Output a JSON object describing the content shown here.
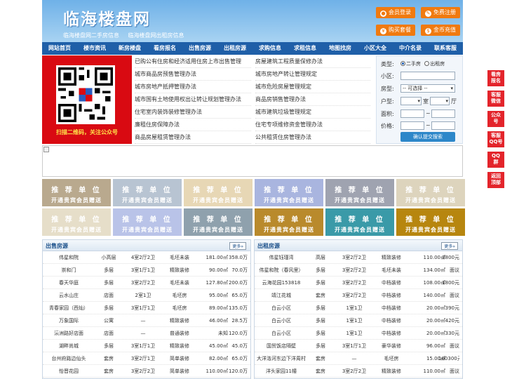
{
  "header": {
    "title": "临海楼盘网",
    "subtitle_links": [
      "临海楼盘网二手房信息",
      "临海楼盘网出租房信息"
    ],
    "buttons": [
      {
        "label": "会员登录",
        "icon": "user-icon"
      },
      {
        "label": "免费注册",
        "icon": "pen-icon"
      },
      {
        "label": "购买套餐",
        "icon": "cart-icon"
      },
      {
        "label": "金币充值",
        "icon": "coin-icon"
      }
    ]
  },
  "nav": [
    "网站首页",
    "楼市资讯",
    "新房楼盘",
    "看房报名",
    "出售房源",
    "出租房源",
    "求购信息",
    "求租信息",
    "地图找房",
    "小区大全",
    "中介名录",
    "联系客服"
  ],
  "qr": {
    "caption": "扫描二维码，关注公众号",
    "accent": "#d90a12"
  },
  "links": {
    "left": [
      "已购公有住房和经济适用住房上市出售管理",
      "城市商品房预售管理办法",
      "城市房地产抵押管理办法",
      "城市国有土地使用权出让转让规划管理办法",
      "住宅室内装饰装修管理办法",
      "廉租住房保障办法",
      "商品房屋租赁管理办法"
    ],
    "right": [
      "房屋建筑工程质量保修办法",
      "城市房地产转让管理规定",
      "城市危险房屋管理规定",
      "商品房销售管理办法",
      "城市建筑垃圾管理规定",
      "住宅专项维修资金管理办法",
      "公共租赁住房管理办法"
    ]
  },
  "search": {
    "type_label": "类型:",
    "type_options": [
      "二手房",
      "出租房"
    ],
    "community_label": "小区:",
    "house_type_label": "房型:",
    "house_type_value": "-- 可选择 --",
    "layout_label": "户型:",
    "room_unit": "室",
    "hall_unit": "厅",
    "area_label": "面积:",
    "price_label": "价格:",
    "range_sep": "~",
    "submit_label": "确认提交搜索"
  },
  "ads": {
    "line1": "推 荐 单 位",
    "line2": "开通贵宾会员赠送"
  },
  "sale": {
    "title": "出售房源",
    "more": "更多»",
    "rows": [
      [
        "伟星和院",
        "小高层",
        "4室2厅2卫",
        "毛坯未装",
        "181.00㎡",
        "358.0万"
      ],
      [
        "崇和门",
        "多层",
        "3室1厅1卫",
        "精致装修",
        "90.00㎡",
        "70.0万"
      ],
      [
        "春天华庭",
        "多层",
        "3室2厅2卫",
        "毛坯未装",
        "127.80㎡",
        "200.0万"
      ],
      [
        "云水山庄",
        "店面",
        "2室1卫",
        "毛坯房",
        "95.00㎡",
        "65.0万"
      ],
      [
        "青春家园（西灿）",
        "多层",
        "3室1厅1卫",
        "毛坯房",
        "89.00㎡",
        "135.0万"
      ],
      [
        "万象国际",
        "公寓",
        "—",
        "精致装修",
        "46.00㎡",
        "28.5万"
      ],
      [
        "沄洲路好店面",
        "店面",
        "—",
        "普通装修",
        "未知",
        "120.0万"
      ],
      [
        "湖畔尚城",
        "多层",
        "3室1厅1卫",
        "精致装修",
        "45.00㎡",
        "45.0万"
      ],
      [
        "台州府路边仙头",
        "套房",
        "3室2厅1卫",
        "简单装修",
        "82.00㎡",
        "65.0万"
      ],
      [
        "怡晋花园",
        "套房",
        "3室2厅2卫",
        "简单装修",
        "110.00㎡",
        "120.0万"
      ]
    ]
  },
  "rent": {
    "title": "出租房源",
    "more": "更多»",
    "rows": [
      [
        "伟星钰瑾湾",
        "高层",
        "3室2厅2卫",
        "精致装修",
        "110.00㎡",
        "2800元"
      ],
      [
        "伟星和院（春风里）",
        "多层",
        "3室2厅2卫",
        "毛坯未装",
        "134.00㎡",
        "面议"
      ],
      [
        "云海花园153818",
        "多层",
        "3室2厅2卫",
        "中档装修",
        "108.00㎡",
        "1800元"
      ],
      [
        "靖江花城",
        "套房",
        "3室2厅2卫",
        "中档装修",
        "140.00㎡",
        "面议"
      ],
      [
        "白云小区",
        "多层",
        "1室1卫",
        "中档装修",
        "20.00㎡",
        "390元"
      ],
      [
        "白云小区",
        "多层",
        "1室1卫",
        "中档装修",
        "20.00㎡",
        "420元"
      ],
      [
        "白云小区",
        "多层",
        "1室1卫",
        "中档装修",
        "20.00㎡",
        "330元"
      ],
      [
        "国贸饭店隔壁",
        "多层",
        "3室1厅1卫",
        "豪华装修",
        "96.00㎡",
        "面议"
      ],
      [
        "大洋洛河东边下洋周村",
        "套房",
        "—",
        "毛坯房",
        "15.00㎡",
        "100300元"
      ],
      [
        "洋头家园11幢",
        "套房",
        "3室2厅2卫",
        "精致装修",
        "110.00㎡",
        "面议"
      ]
    ]
  },
  "side": [
    {
      "label": "看房\n报名",
      "icon": "calendar-icon"
    },
    {
      "label": "客服\n微信",
      "icon": "wechat-icon"
    },
    {
      "label": "公众\n号",
      "icon": "qrcode-icon"
    },
    {
      "label": "客服\nQQ号",
      "icon": "qq-icon"
    },
    {
      "label": "QQ\n群",
      "icon": "group-icon"
    },
    {
      "label": "返回\n顶部",
      "icon": "arrow-up-icon"
    }
  ],
  "colors": {
    "nav": "#1f5fa8",
    "button": "#f07a10",
    "side": "#e3242b"
  }
}
